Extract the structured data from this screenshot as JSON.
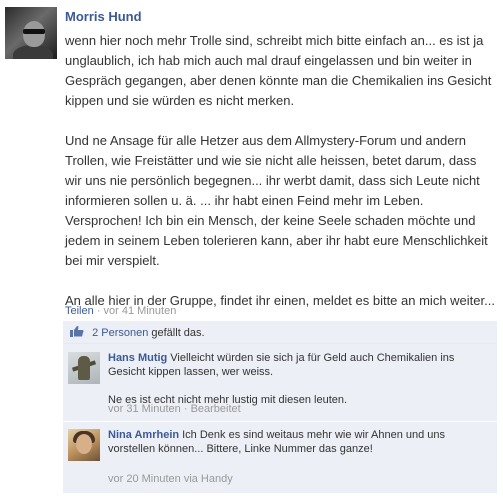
{
  "post": {
    "author": "Morris Hund",
    "paragraphs": [
      "wenn hier noch mehr Trolle sind, schreibt mich bitte einfach an... es ist ja unglaublich, ich hab mich auch mal drauf eingelassen und bin weiter in Gespräch gegangen, aber denen könnte man die Chemikalien ins Gesicht kippen und sie würden es nicht merken.",
      "Und ne Ansage für alle Hetzer aus dem Allmystery-Forum und andern Trollen, wie Freistätter und wie sie nicht alle heissen, betet darum, dass wir uns nie persönlich begegnen... ihr werbt damit, dass sich Leute nicht informieren sollen u. ä. ... ihr habt einen Feind mehr im Leben. Versprochen! Ich bin ein Mensch, der keine Seele schaden möchte und jedem in seinem Leben tolerieren kann, aber ihr habt eure Menschlichkeit bei mir verspielt.",
      "An alle hier in der Gruppe, findet ihr einen, meldet es bitte an mich weiter..."
    ],
    "share_label": "Teilen",
    "separator": "·",
    "timestamp": "vor 41 Minuten"
  },
  "likes": {
    "people_link": "2 Personen",
    "suffix": "gefällt das."
  },
  "comments": [
    {
      "author": "Hans Mutig",
      "text": "Vielleicht würden sie sich ja für Geld auch Chemikalien ins Gesicht kippen lassen, wer weiss.",
      "text2": "Ne es ist echt nicht mehr lustig mit diesen leuten.",
      "timestamp": "vor 31 Minuten",
      "separator": "·",
      "extra": "Bearbeitet"
    },
    {
      "author": "Nina Amrhein",
      "text": "Ich Denk es sind weitaus mehr wie wir Ahnen und uns vorstellen können... Bittere, Linke Nummer das ganze!",
      "timestamp": "vor 20 Minuten via Handy"
    }
  ],
  "colors": {
    "link": "#3b5998",
    "meta": "#999999",
    "feedback_bg": "#eceff5"
  },
  "icons": {
    "like": "thumbs-up-icon"
  }
}
